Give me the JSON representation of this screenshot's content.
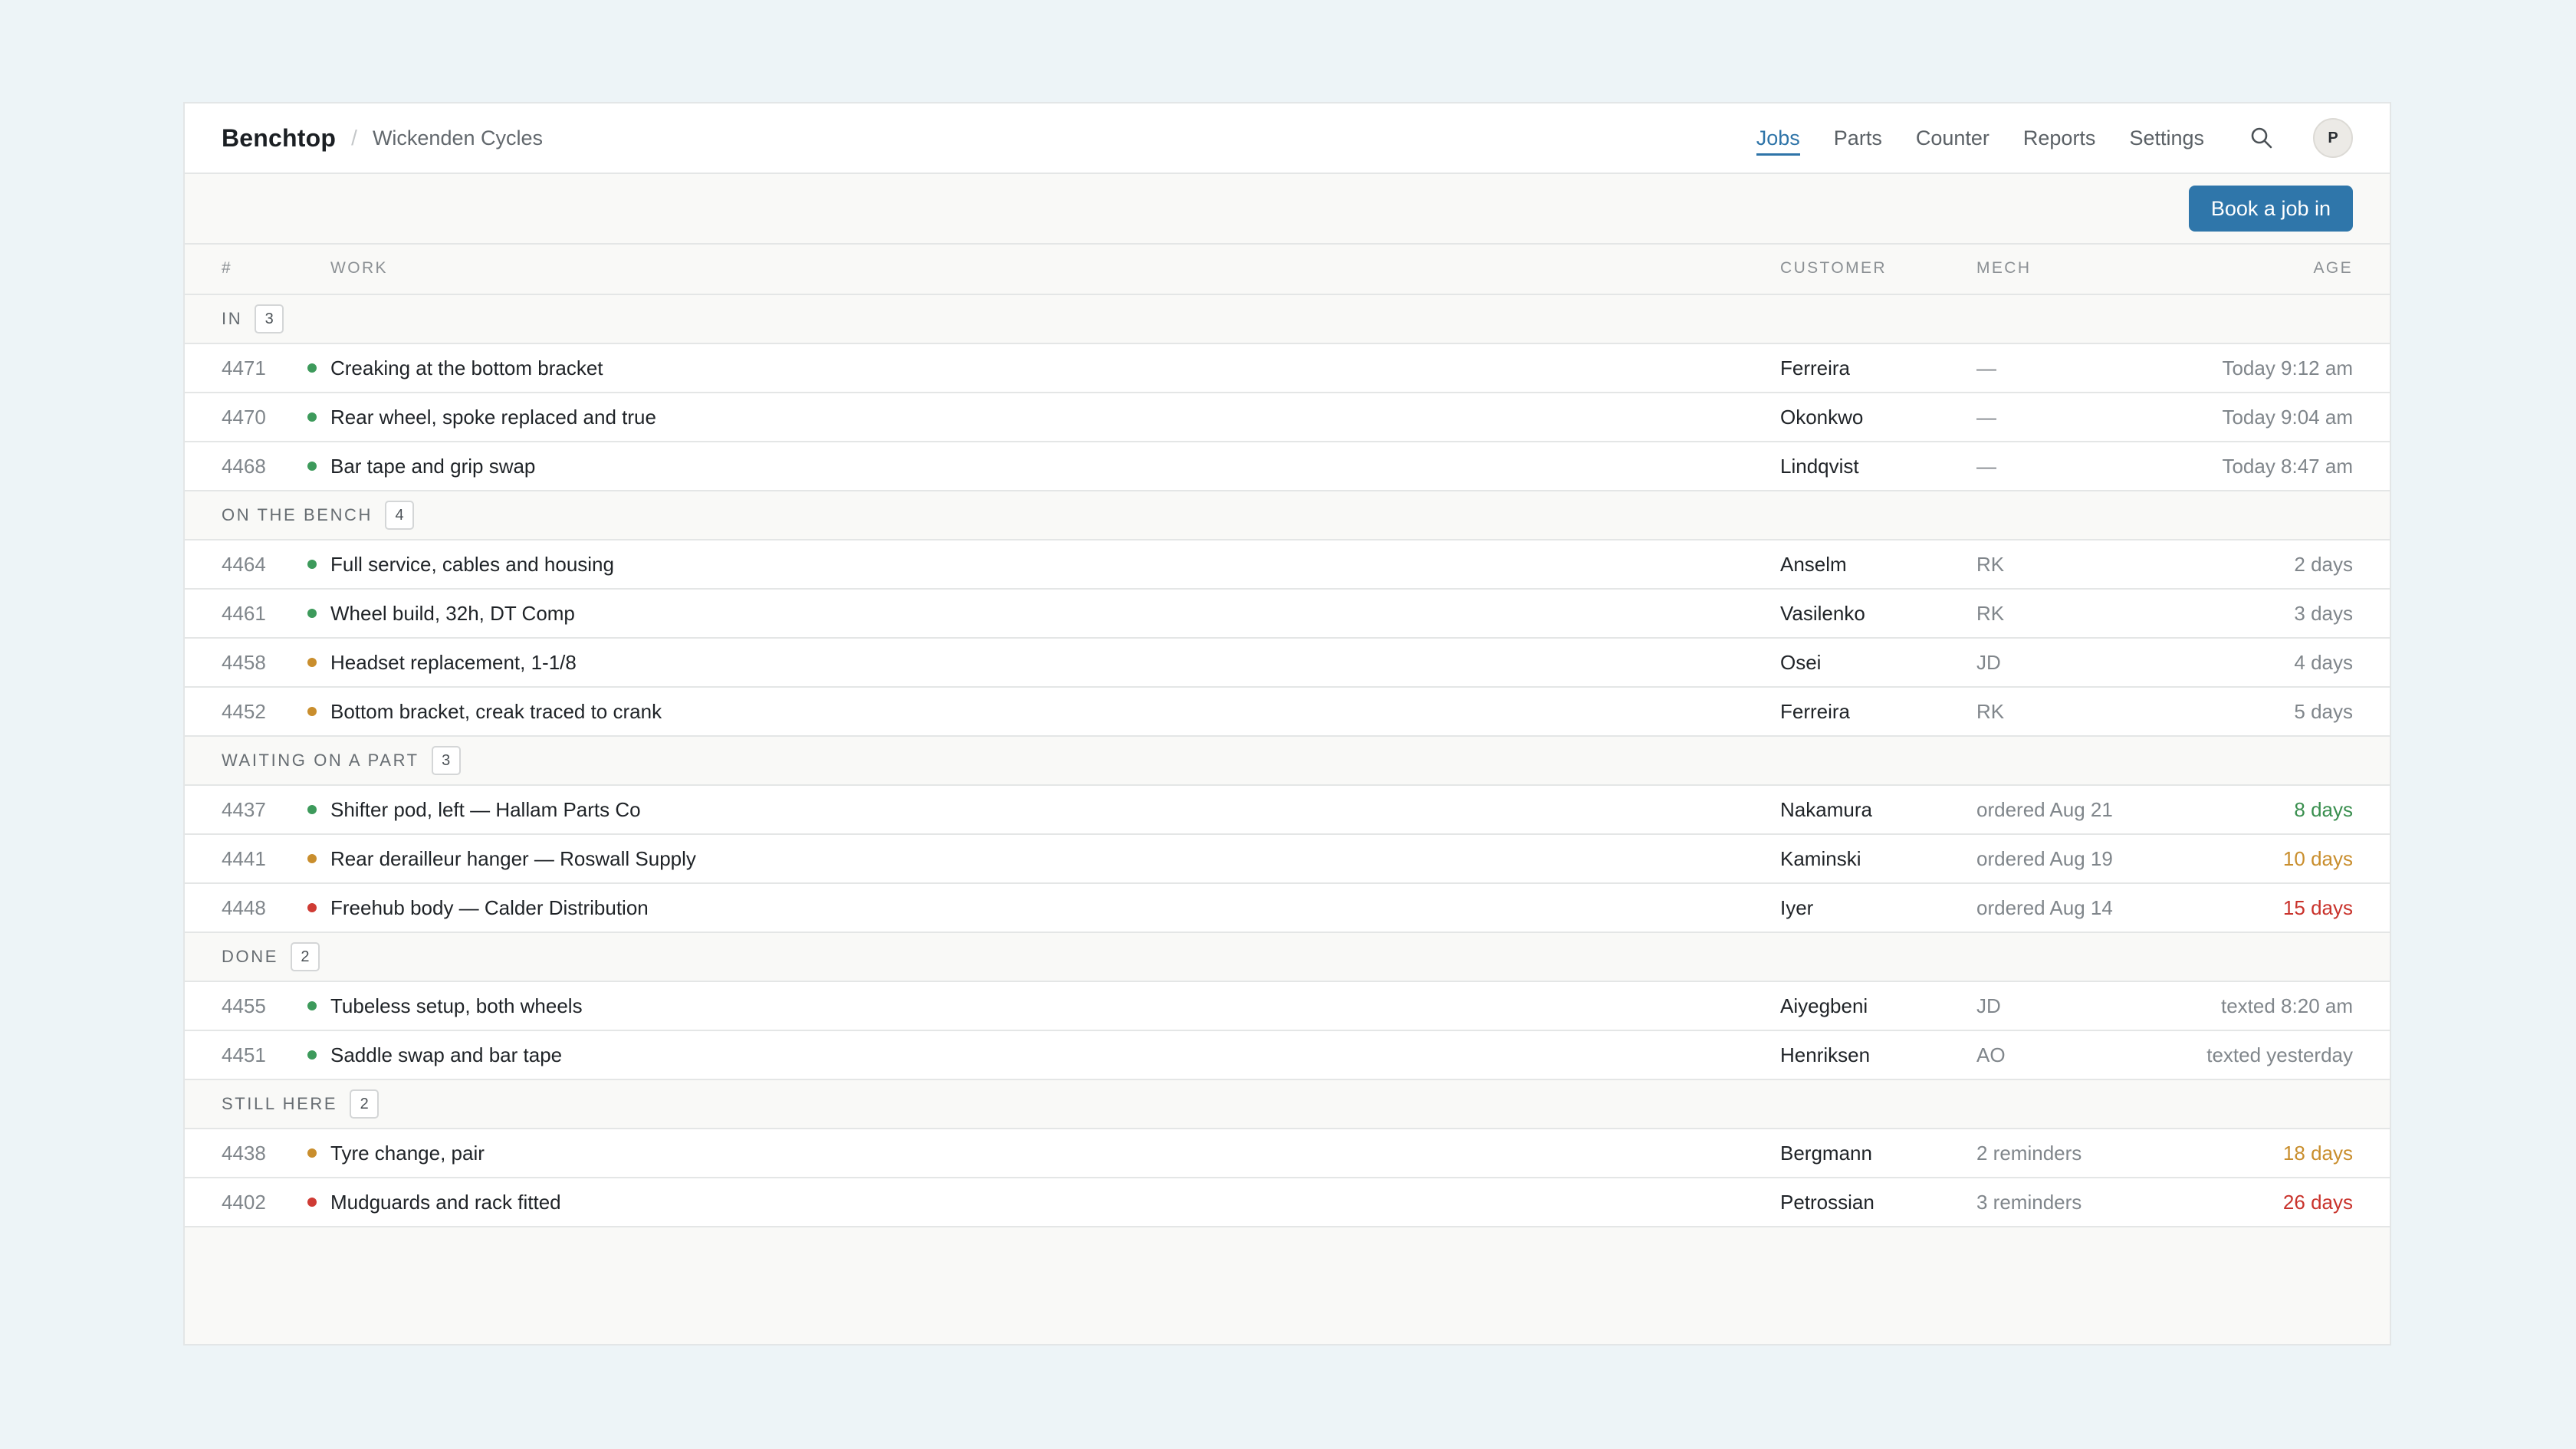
{
  "app": {
    "brand": "Benchtop",
    "separator": "/",
    "shop": "Wickenden Cycles"
  },
  "nav": {
    "items": [
      {
        "label": "Jobs",
        "active": true
      },
      {
        "label": "Parts",
        "active": false
      },
      {
        "label": "Counter",
        "active": false
      },
      {
        "label": "Reports",
        "active": false
      },
      {
        "label": "Settings",
        "active": false
      }
    ],
    "search_icon": "search-icon",
    "avatar_initial": "P"
  },
  "toolbar": {
    "book_label": "Book a job in"
  },
  "columns": {
    "num": "#",
    "work": "WORK",
    "customer": "CUSTOMER",
    "mech": "MECH",
    "age": "AGE"
  },
  "colors": {
    "accent": "#2f76aa",
    "status_green": "#3d9a5b",
    "status_amber": "#c98e2d",
    "status_red": "#cf3b34",
    "age_green": "#3a8f4f",
    "age_amber": "#c98e2d",
    "age_red": "#c9332c"
  },
  "groups": [
    {
      "label": "IN",
      "count": "3",
      "jobs": [
        {
          "num": "4471",
          "status": "green",
          "work": "Creaking at the bottom bracket",
          "customer": "Ferreira",
          "mech": "—",
          "age": "Today 9:12 am",
          "age_tone": "default"
        },
        {
          "num": "4470",
          "status": "green",
          "work": "Rear wheel, spoke replaced and true",
          "customer": "Okonkwo",
          "mech": "—",
          "age": "Today 9:04 am",
          "age_tone": "default"
        },
        {
          "num": "4468",
          "status": "green",
          "work": "Bar tape and grip swap",
          "customer": "Lindqvist",
          "mech": "—",
          "age": "Today 8:47 am",
          "age_tone": "default"
        }
      ]
    },
    {
      "label": "ON THE BENCH",
      "count": "4",
      "jobs": [
        {
          "num": "4464",
          "status": "green",
          "work": "Full service, cables and housing",
          "customer": "Anselm",
          "mech": "RK",
          "age": "2 days",
          "age_tone": "default"
        },
        {
          "num": "4461",
          "status": "green",
          "work": "Wheel build, 32h, DT Comp",
          "customer": "Vasilenko",
          "mech": "RK",
          "age": "3 days",
          "age_tone": "default"
        },
        {
          "num": "4458",
          "status": "amber",
          "work": "Headset replacement, 1-1/8",
          "customer": "Osei",
          "mech": "JD",
          "age": "4 days",
          "age_tone": "default"
        },
        {
          "num": "4452",
          "status": "amber",
          "work": "Bottom bracket, creak traced to crank",
          "customer": "Ferreira",
          "mech": "RK",
          "age": "5 days",
          "age_tone": "default"
        }
      ]
    },
    {
      "label": "WAITING ON A PART",
      "count": "3",
      "jobs": [
        {
          "num": "4437",
          "status": "green",
          "work": "Shifter pod, left — Hallam Parts Co",
          "customer": "Nakamura",
          "mech": "ordered Aug 21",
          "age": "8 days",
          "age_tone": "green"
        },
        {
          "num": "4441",
          "status": "amber",
          "work": "Rear derailleur hanger — Roswall Supply",
          "customer": "Kaminski",
          "mech": "ordered Aug 19",
          "age": "10 days",
          "age_tone": "amber"
        },
        {
          "num": "4448",
          "status": "red",
          "work": "Freehub body — Calder Distribution",
          "customer": "Iyer",
          "mech": "ordered Aug 14",
          "age": "15 days",
          "age_tone": "red"
        }
      ]
    },
    {
      "label": "DONE",
      "count": "2",
      "jobs": [
        {
          "num": "4455",
          "status": "green",
          "work": "Tubeless setup, both wheels",
          "customer": "Aiyegbeni",
          "mech": "JD",
          "age": "texted 8:20 am",
          "age_tone": "default"
        },
        {
          "num": "4451",
          "status": "green",
          "work": "Saddle swap and bar tape",
          "customer": "Henriksen",
          "mech": "AO",
          "age": "texted yesterday",
          "age_tone": "default"
        }
      ]
    },
    {
      "label": "STILL HERE",
      "count": "2",
      "jobs": [
        {
          "num": "4438",
          "status": "amber",
          "work": "Tyre change, pair",
          "customer": "Bergmann",
          "mech": "2 reminders",
          "age": "18 days",
          "age_tone": "amber"
        },
        {
          "num": "4402",
          "status": "red",
          "work": "Mudguards and rack fitted",
          "customer": "Petrossian",
          "mech": "3 reminders",
          "age": "26 days",
          "age_tone": "red"
        }
      ]
    }
  ]
}
